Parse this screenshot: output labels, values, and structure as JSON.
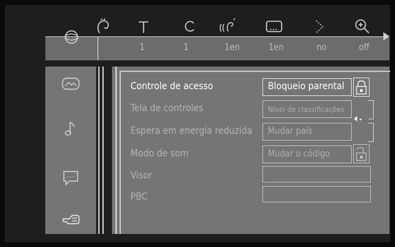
{
  "topbar": {
    "values": [
      "1",
      "1",
      "1en",
      "1en",
      "no",
      "off"
    ]
  },
  "menu": {
    "items": [
      "Controle de acesso",
      "Tela de controles",
      "Espera em energia reduzida",
      "Modo de som",
      "Visor",
      "PBC"
    ]
  },
  "submenu": {
    "items": [
      "Bloqueio parental",
      "Nível de classificações",
      "Mudar país",
      "Mudar o código"
    ]
  },
  "colors": {
    "background": "#1e1e1e",
    "panel": "#757575",
    "active_text": "#ffffff",
    "inactive_text": "#b4b4b4"
  }
}
